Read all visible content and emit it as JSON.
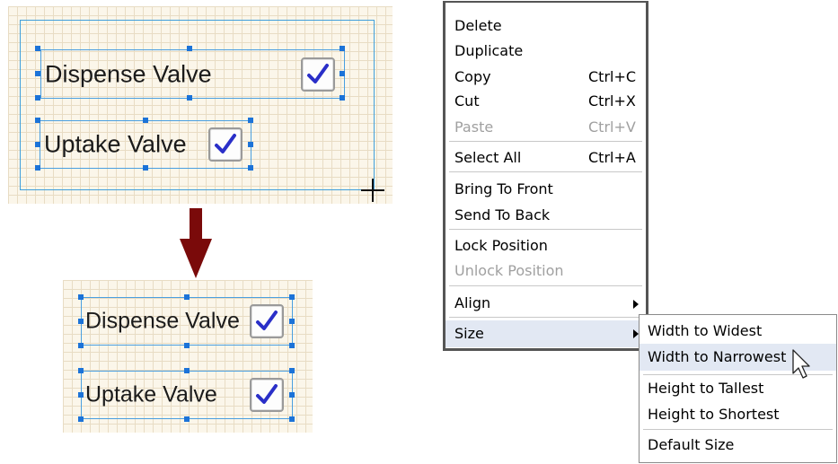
{
  "before_canvas": {
    "controls": [
      {
        "label": "Dispense Valve",
        "checked": true
      },
      {
        "label": "Uptake Valve",
        "checked": true
      }
    ]
  },
  "after_canvas": {
    "controls": [
      {
        "label": "Dispense Valve",
        "checked": true
      },
      {
        "label": "Uptake Valve",
        "checked": true
      }
    ]
  },
  "context_menu": {
    "items": [
      {
        "label": "Delete",
        "shortcut": "",
        "enabled": true
      },
      {
        "label": "Duplicate",
        "shortcut": "",
        "enabled": true
      },
      {
        "label": "Copy",
        "shortcut": "Ctrl+C",
        "enabled": true
      },
      {
        "label": "Cut",
        "shortcut": "Ctrl+X",
        "enabled": true
      },
      {
        "label": "Paste",
        "shortcut": "Ctrl+V",
        "enabled": false
      },
      {
        "label": "Select All",
        "shortcut": "Ctrl+A",
        "enabled": true
      },
      {
        "label": "Bring To Front",
        "shortcut": "",
        "enabled": true
      },
      {
        "label": "Send To Back",
        "shortcut": "",
        "enabled": true
      },
      {
        "label": "Lock Position",
        "shortcut": "",
        "enabled": true
      },
      {
        "label": "Unlock Position",
        "shortcut": "",
        "enabled": false
      },
      {
        "label": "Align",
        "shortcut": "",
        "enabled": true,
        "submenu": true
      },
      {
        "label": "Size",
        "shortcut": "",
        "enabled": true,
        "submenu": true,
        "highlighted": true
      }
    ]
  },
  "size_submenu": {
    "items": [
      {
        "label": "Width to Widest"
      },
      {
        "label": "Width to Narrowest",
        "highlighted": true
      },
      {
        "label": "Height to Tallest"
      },
      {
        "label": "Height to Shortest"
      },
      {
        "label": "Default Size"
      }
    ]
  },
  "colors": {
    "canvas_bg": "#fbf6ea",
    "selection_border": "#4a9fe0",
    "handle": "#1c73d8",
    "checkmark": "#2a2fc8",
    "arrow": "#7a0a0a",
    "menu_highlight": "#e2e8f3",
    "disabled_text": "#a0a0a0"
  },
  "icons": [
    "checkmark-icon",
    "crosshair-cursor-icon",
    "down-arrow-icon",
    "submenu-arrow-icon",
    "mouse-pointer-icon"
  ]
}
